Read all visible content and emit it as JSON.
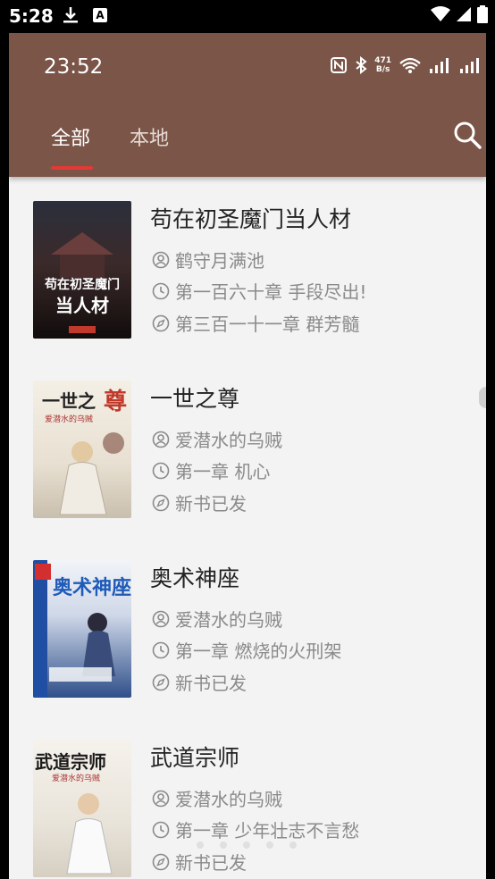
{
  "device_status": {
    "time": "5:28",
    "notification_a": "A"
  },
  "app_status": {
    "time": "23:52",
    "net_speed_value": "471",
    "net_speed_unit": "B/s"
  },
  "tabs": [
    {
      "label": "全部",
      "active": true
    },
    {
      "label": "本地",
      "active": false
    }
  ],
  "books": [
    {
      "title": "苟在初圣魔门当人材",
      "author": "鹤守月满池",
      "last_read": "第一百六十章 手段尽出!",
      "latest": "第三百一十一章 群芳髓"
    },
    {
      "title": "一世之尊",
      "author": "爱潜水的乌贼",
      "last_read": "第一章 机心",
      "latest": "新书已发"
    },
    {
      "title": "奥术神座",
      "author": "爱潜水的乌贼",
      "last_read": "第一章 燃烧的火刑架",
      "latest": "新书已发"
    },
    {
      "title": "武道宗师",
      "author": "爱潜水的乌贼",
      "last_read": "第一章 少年壮志不言愁",
      "latest": "新书已发"
    }
  ],
  "colors": {
    "app_bar": "#7b5648",
    "tab_indicator": "#e53935",
    "background": "#f3f3f3"
  }
}
